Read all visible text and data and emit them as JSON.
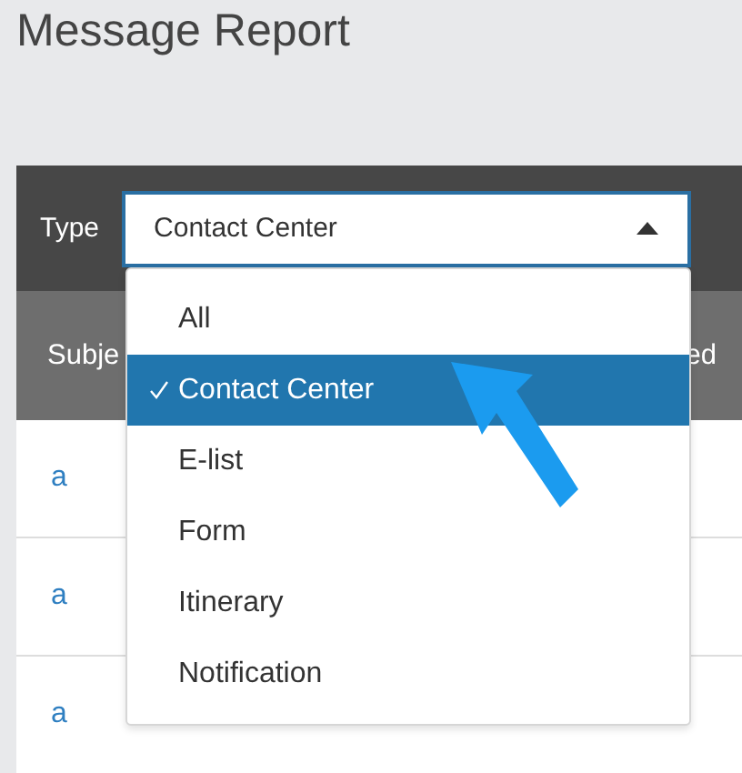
{
  "page": {
    "title": "Message Report"
  },
  "filter": {
    "label": "Type",
    "value": "Contact Center",
    "expanded": true,
    "options": [
      {
        "label": "All",
        "selected": false
      },
      {
        "label": "Contact Center",
        "selected": true
      },
      {
        "label": "E-list",
        "selected": false
      },
      {
        "label": "Form",
        "selected": false
      },
      {
        "label": "Itinerary",
        "selected": false
      },
      {
        "label": "Notification",
        "selected": false
      }
    ]
  },
  "table": {
    "columns": [
      "Subje",
      "ed"
    ],
    "rows": [
      {
        "subject": "a"
      },
      {
        "subject": "a"
      },
      {
        "subject": "a"
      }
    ]
  }
}
